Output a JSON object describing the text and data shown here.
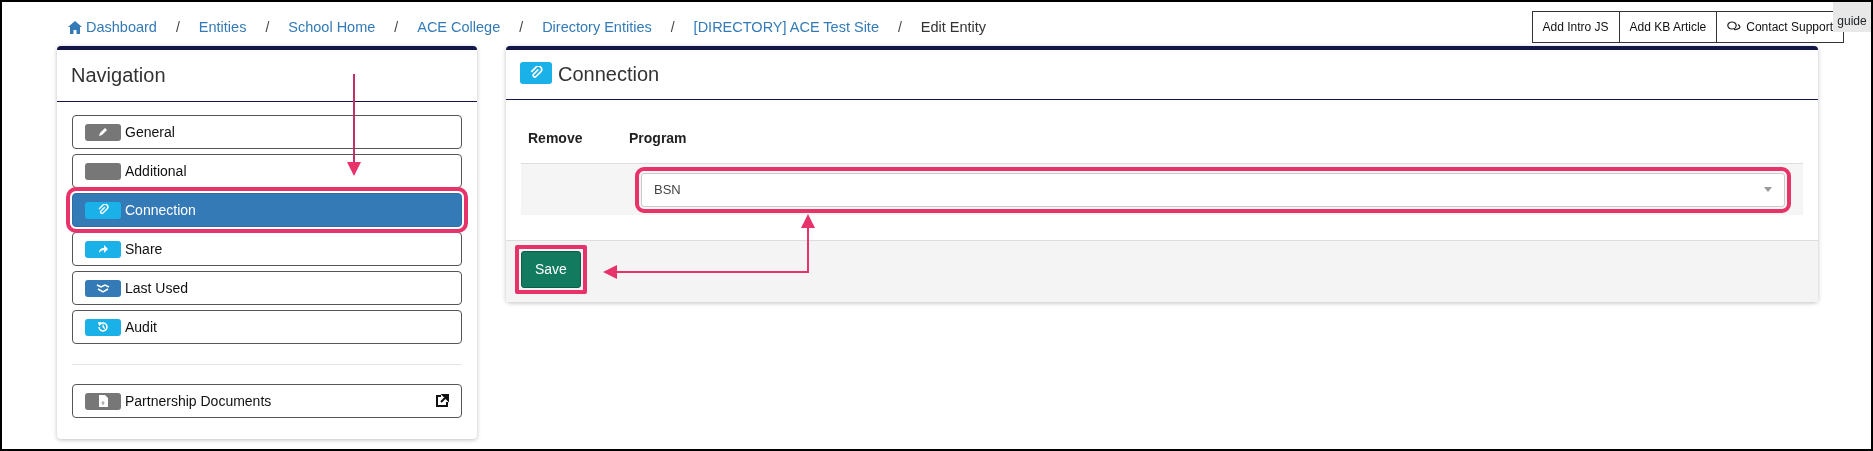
{
  "breadcrumb": [
    {
      "label": "Dashboard",
      "current": false
    },
    {
      "label": "Entities",
      "current": false
    },
    {
      "label": "School Home",
      "current": false
    },
    {
      "label": "ACE College",
      "current": false
    },
    {
      "label": "Directory Entities",
      "current": false
    },
    {
      "label": "[DIRECTORY] ACE Test Site",
      "current": false
    },
    {
      "label": "Edit Entity",
      "current": true
    }
  ],
  "breadcrumb_separator": "/",
  "toolbar_buttons": [
    "Add Intro JS",
    "Add KB Article",
    "Contact Support"
  ],
  "guide_tab": {
    "label": "guide"
  },
  "navigation": {
    "title": "Navigation",
    "items": [
      {
        "label": "General",
        "selected": false,
        "highlighted": false
      },
      {
        "label": "Additional",
        "selected": false,
        "highlighted": false
      },
      {
        "label": "Connection",
        "selected": true,
        "highlighted": true
      },
      {
        "label": "Share",
        "selected": false,
        "highlighted": false
      },
      {
        "label": "Last Used",
        "selected": false,
        "highlighted": false
      },
      {
        "label": "Audit",
        "selected": false,
        "highlighted": false
      }
    ],
    "links": [
      {
        "label": "Partnership Documents"
      }
    ]
  },
  "connection": {
    "title": "Connection",
    "columns": [
      "Remove",
      "Program"
    ],
    "rows": [
      {
        "program": "BSN",
        "highlighted": true
      }
    ],
    "save_button": {
      "label": "Save",
      "highlighted": true
    }
  }
}
